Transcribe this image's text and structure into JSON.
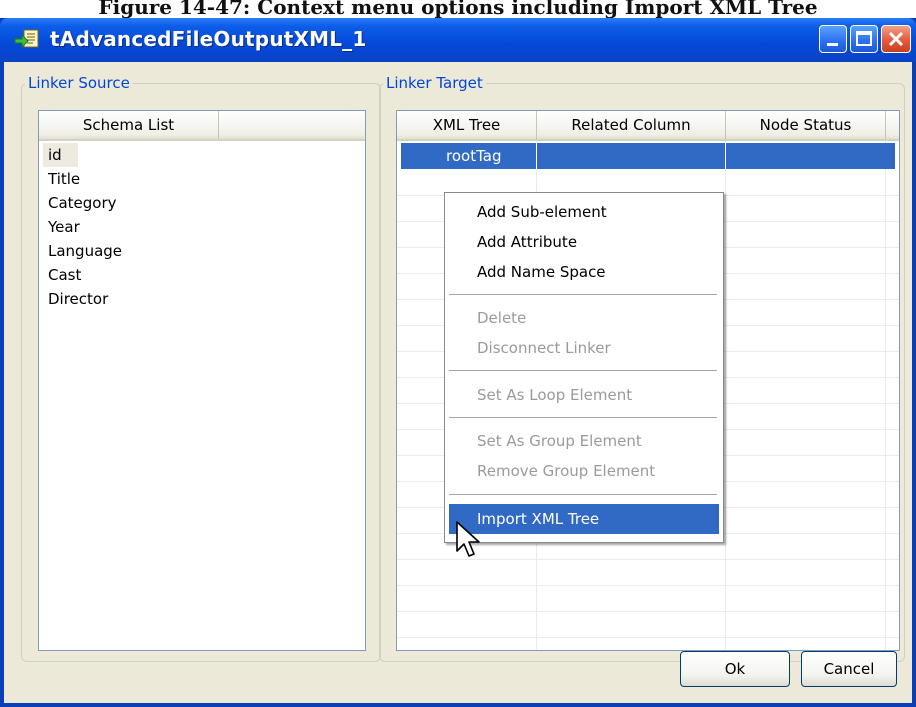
{
  "caption": "Figure 14-47: Context menu options including Import XML Tree",
  "window": {
    "title": "tAdvancedFileOutputXML_1",
    "colors": {
      "titlebar": "#0548d8",
      "selection": "#316ac5",
      "legend_text": "#0046d5"
    }
  },
  "linker_source": {
    "legend": "Linker Source",
    "header": "Schema List",
    "items": [
      "id",
      "Title",
      "Category",
      "Year",
      "Language",
      "Cast",
      "Director"
    ]
  },
  "linker_target": {
    "legend": "Linker Target",
    "columns": [
      "XML Tree",
      "Related Column",
      "Node Status"
    ],
    "rows": [
      {
        "xml_tree": "rootTag",
        "related_column": "",
        "node_status": ""
      }
    ]
  },
  "context_menu": {
    "items": [
      {
        "label": "Add Sub-element",
        "enabled": true
      },
      {
        "label": "Add Attribute",
        "enabled": true
      },
      {
        "label": "Add Name Space",
        "enabled": true
      },
      {
        "label": "Delete",
        "enabled": false
      },
      {
        "label": "Disconnect Linker",
        "enabled": false
      },
      {
        "label": "Set As Loop Element",
        "enabled": false
      },
      {
        "label": "Set As Group Element",
        "enabled": false
      },
      {
        "label": "Remove Group Element",
        "enabled": false
      },
      {
        "label": "Import XML Tree",
        "enabled": true,
        "highlighted": true
      }
    ]
  },
  "buttons": {
    "ok": "Ok",
    "cancel": "Cancel"
  },
  "icons": [
    "app-icon",
    "minimize-icon",
    "maximize-icon",
    "close-icon",
    "mouse-cursor-icon"
  ]
}
